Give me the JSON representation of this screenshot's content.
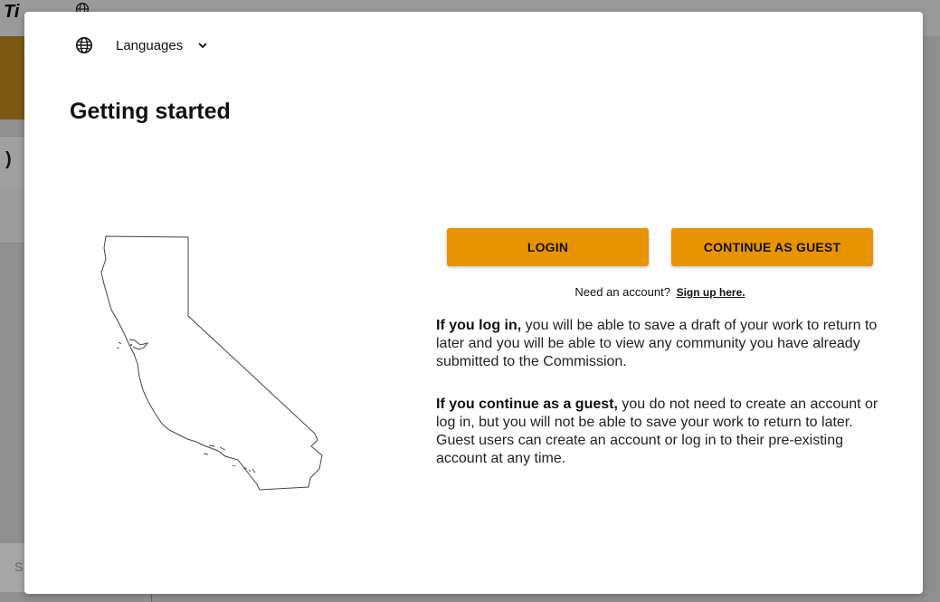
{
  "background": {
    "title_fragment": "Ti",
    "letter_fragment": "S",
    "paren_fragment": ")"
  },
  "modal": {
    "language_selector": {
      "label": "Languages",
      "icon": "globe-icon",
      "chevron": "chevron-down-icon"
    },
    "title": "Getting started",
    "map_alt": "California map outline",
    "buttons": {
      "login": "LOGIN",
      "guest": "CONTINUE AS GUEST"
    },
    "signup": {
      "prompt": "Need an account?",
      "link": "Sign up here."
    },
    "login_info": {
      "lead": "If you log in,",
      "text": " you will be able to save a draft of your work to return to later and you will be able to view any community you have already submitted to the Commission."
    },
    "guest_info": {
      "lead": "If you continue as a guest,",
      "text": " you do not need to create an account or log in, but you will not be able to save your work to return to later. Guest users can create an account or log in to their pre-existing account at any time."
    }
  },
  "colors": {
    "accent": "#e89300",
    "overlay": "#8f8f8f",
    "modal_bg": "#ffffff"
  }
}
